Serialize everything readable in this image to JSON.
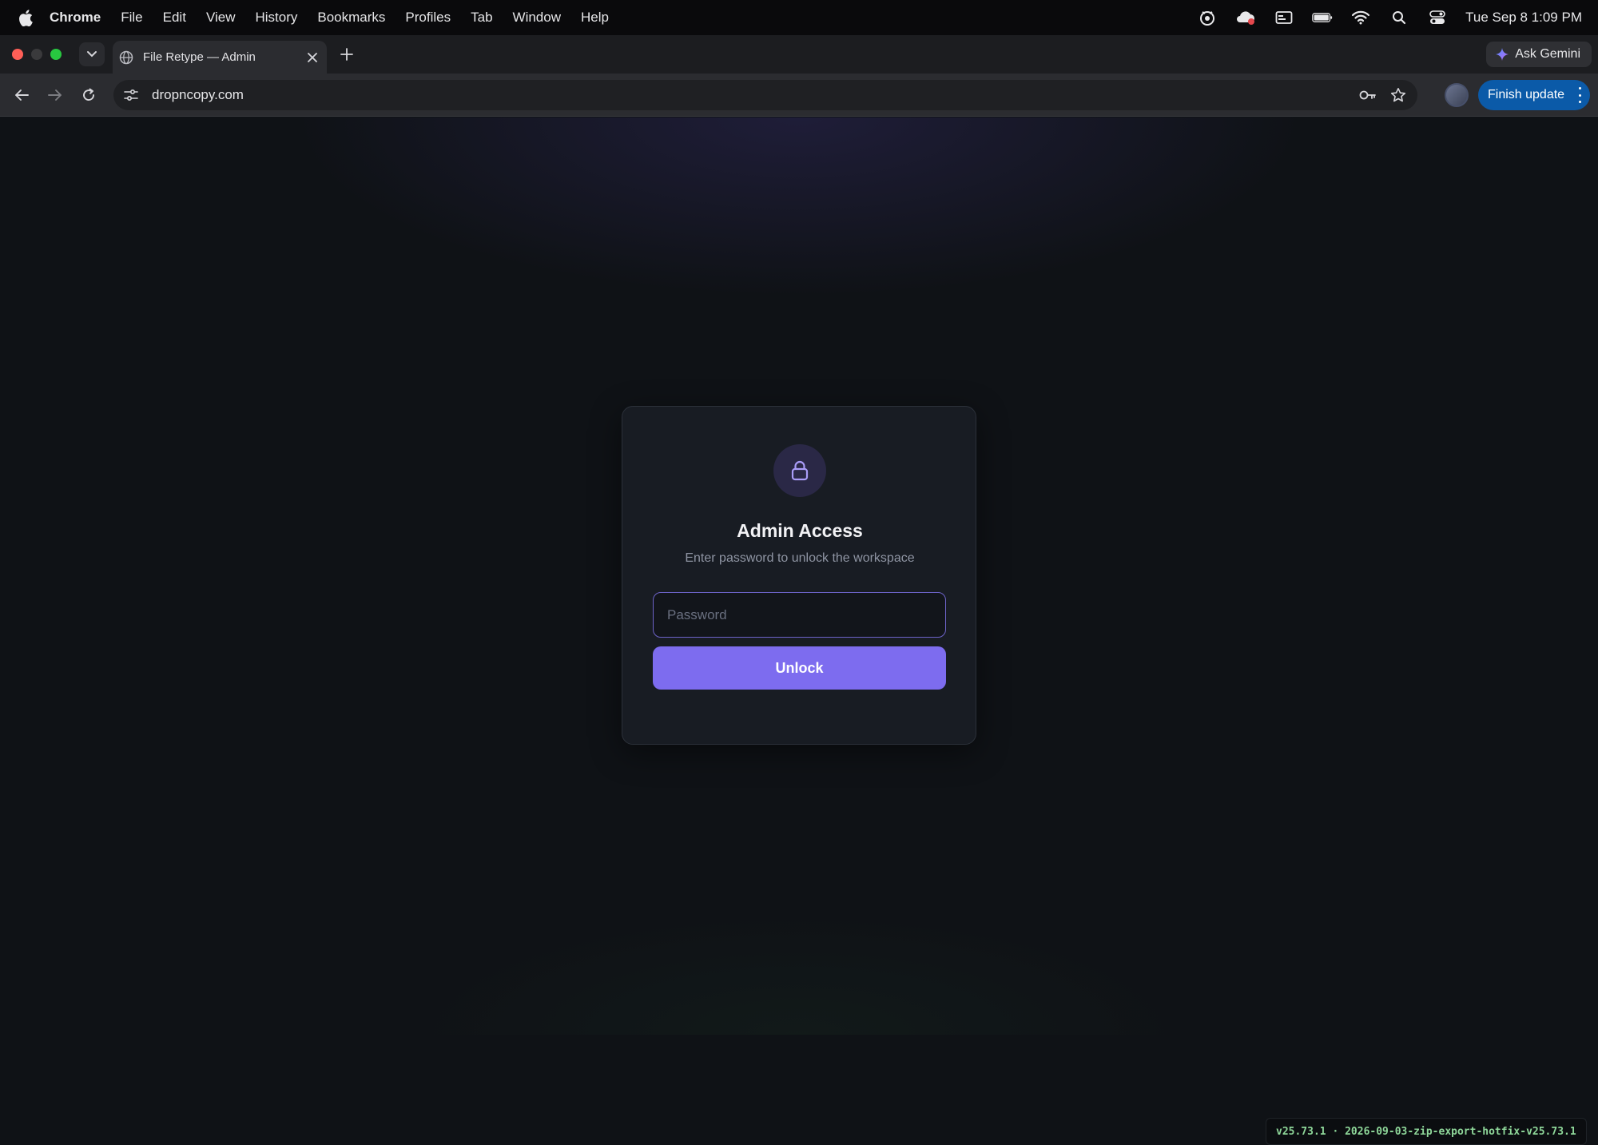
{
  "menubar": {
    "app_name": "Chrome",
    "items": [
      "File",
      "Edit",
      "View",
      "History",
      "Bookmarks",
      "Profiles",
      "Tab",
      "Window",
      "Help"
    ],
    "clock": "Tue Sep 8  1:09 PM"
  },
  "tabstrip": {
    "active_tab_title": "File Retype — Admin",
    "ask_gemini_label": "Ask Gemini"
  },
  "toolbar": {
    "url": "dropncopy.com",
    "finish_update_label": "Finish update"
  },
  "login": {
    "title": "Admin Access",
    "subtitle": "Enter password to unlock the workspace",
    "password_placeholder": "Password",
    "password_value": "",
    "unlock_label": "Unlock"
  },
  "footer": {
    "version": "v25.73.1 · 2026-09-03-zip-export-hotfix-v25.73.1"
  },
  "colors": {
    "accent": "#7d6cef",
    "input_border": "#6d63c9",
    "finish_update_bg": "#0b5aa8",
    "version_text": "#8fd89a",
    "page_bg": "#0f1216"
  },
  "icons": {
    "menubar": [
      "apple-icon",
      "record-icon",
      "cloud-icon",
      "card-icon",
      "battery-icon",
      "wifi-icon",
      "spotlight-icon",
      "control-center-icon"
    ],
    "tab": [
      "tab-search-icon",
      "globe-icon",
      "close-icon",
      "plus-icon"
    ],
    "toolbar": [
      "back-icon",
      "forward-icon",
      "reload-icon",
      "site-info-icon",
      "password-key-icon",
      "star-icon",
      "more-vertical-icon"
    ],
    "login": [
      "lock-icon"
    ]
  }
}
